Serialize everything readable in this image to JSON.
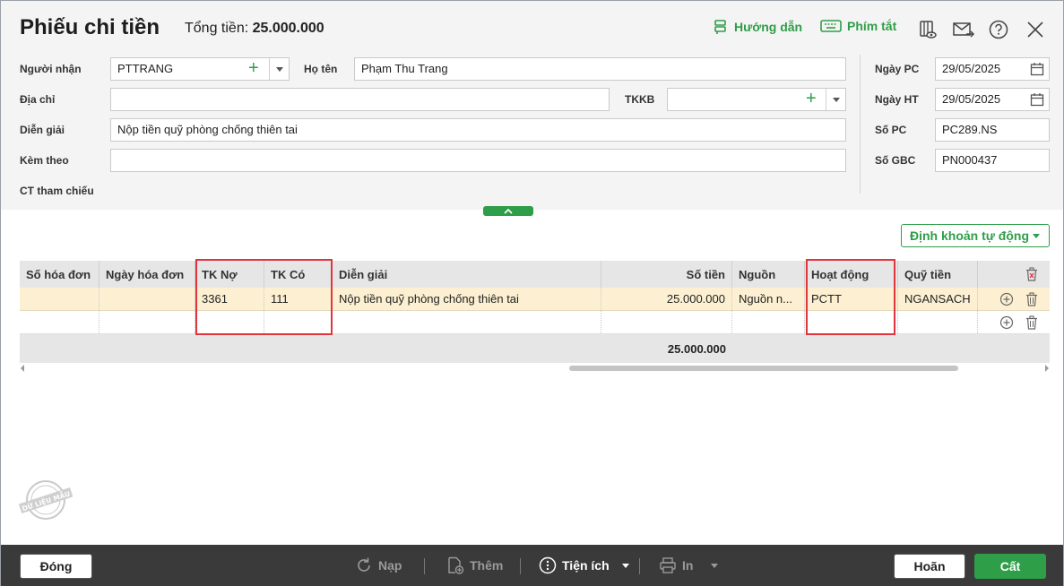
{
  "window": {
    "title": "Phiếu chi tiền",
    "total_label": "Tổng tiền:",
    "total_value": "25.000.000",
    "guide_label": "Hướng dẫn",
    "shortcut_label": "Phím tắt"
  },
  "form": {
    "recipient_label": "Người nhận",
    "recipient_value": "PTTRANG",
    "fullname_label": "Họ tên",
    "fullname_value": "Phạm Thu Trang",
    "address_label": "Địa chỉ",
    "address_value": "",
    "tkkb_label": "TKKB",
    "tkkb_value": "",
    "description_label": "Diễn giải",
    "description_value": "Nộp tiền quỹ phòng chống thiên tai",
    "attach_label": "Kèm theo",
    "attach_value": "",
    "ref_label": "CT tham chiếu"
  },
  "side": {
    "pc_date_label": "Ngày PC",
    "pc_date_value": "29/05/2025",
    "ht_date_label": "Ngày HT",
    "ht_date_value": "29/05/2025",
    "pc_no_label": "Số PC",
    "pc_no_value": "PC289.NS",
    "gbc_no_label": "Số GBC",
    "gbc_no_value": "PN000437"
  },
  "auto_button": "Định khoản tự động",
  "table": {
    "headers": [
      "Số hóa đơn",
      "Ngày hóa đơn",
      "TK Nợ",
      "TK Có",
      "Diễn giải",
      "Số tiền",
      "Nguồn",
      "Hoạt động",
      "Quỹ tiền"
    ],
    "rows": [
      [
        "",
        "",
        "3361",
        "111",
        "Nộp tiền quỹ phòng chống thiên tai",
        "25.000.000",
        "Nguồn n...",
        "PCTT",
        "NGANSACH"
      ],
      [
        "",
        "",
        "",
        "",
        "",
        "",
        "",
        "",
        ""
      ]
    ],
    "total": "25.000.000"
  },
  "footer": {
    "close": "Đóng",
    "reload": "Nạp",
    "add": "Thêm",
    "utility": "Tiện ích",
    "print": "In",
    "cancel": "Hoãn",
    "save": "Cất"
  },
  "watermark": "DỮ LIỆU MẪU",
  "colors": {
    "accent": "#2e9e48",
    "highlight_row": "#fdf0d2",
    "red_box": "#e0353d",
    "footer_bg": "#3a3a3a"
  }
}
